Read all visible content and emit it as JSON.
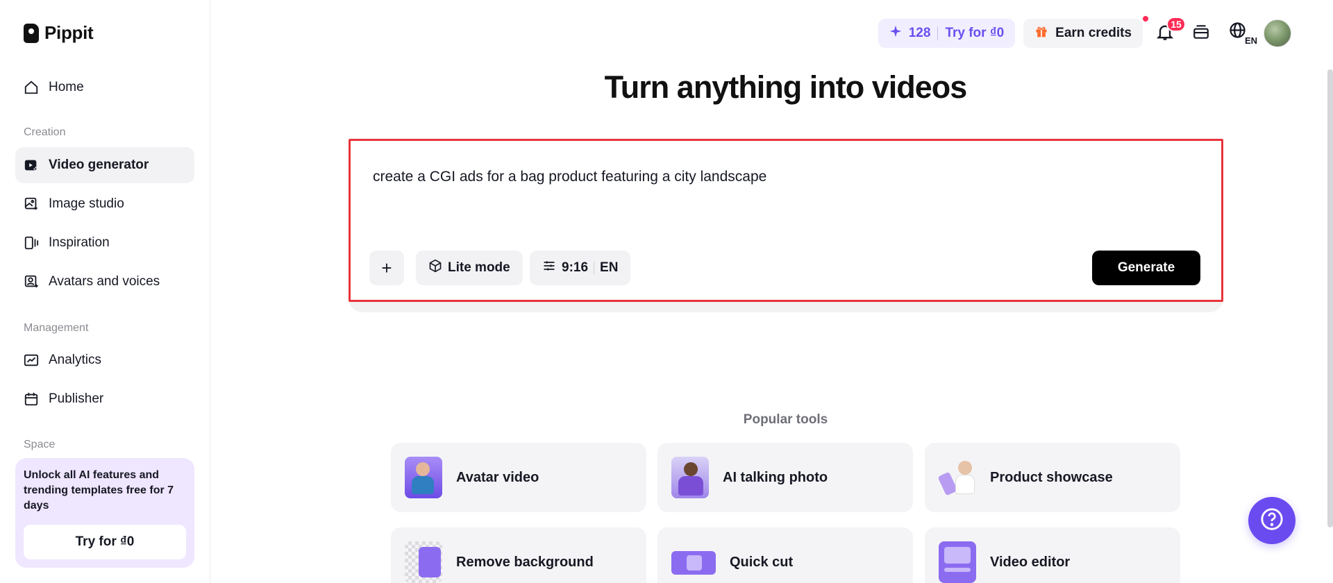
{
  "app": {
    "name": "Pippit"
  },
  "sidebar": {
    "home": "Home",
    "creation_label": "Creation",
    "creation_items": [
      "Video generator",
      "Image studio",
      "Inspiration",
      "Avatars and voices"
    ],
    "management_label": "Management",
    "management_items": [
      "Analytics",
      "Publisher"
    ],
    "space_label": "Space",
    "promo": {
      "text": "Unlock all AI features and trending templates free for 7 days",
      "button": "Try for ₫0"
    }
  },
  "header": {
    "credits": "128",
    "try_label": "Try for ₫0",
    "earn_label": "Earn credits",
    "notification_count": "15",
    "language": "EN"
  },
  "main": {
    "title": "Turn anything into videos",
    "prompt": {
      "value": "create a CGI ads for a bag product featuring a city landscape",
      "plus": "+",
      "mode": "Lite mode",
      "ratio": "9:16",
      "lang": "EN",
      "generate": "Generate"
    },
    "popular_label": "Popular tools",
    "tools": [
      "Avatar video",
      "AI talking photo",
      "Product showcase",
      "Remove background",
      "Quick cut",
      "Video editor"
    ]
  },
  "colors": {
    "accent": "#6a4bf0",
    "badge": "#fe2c55",
    "highlight": "#e8333a"
  }
}
